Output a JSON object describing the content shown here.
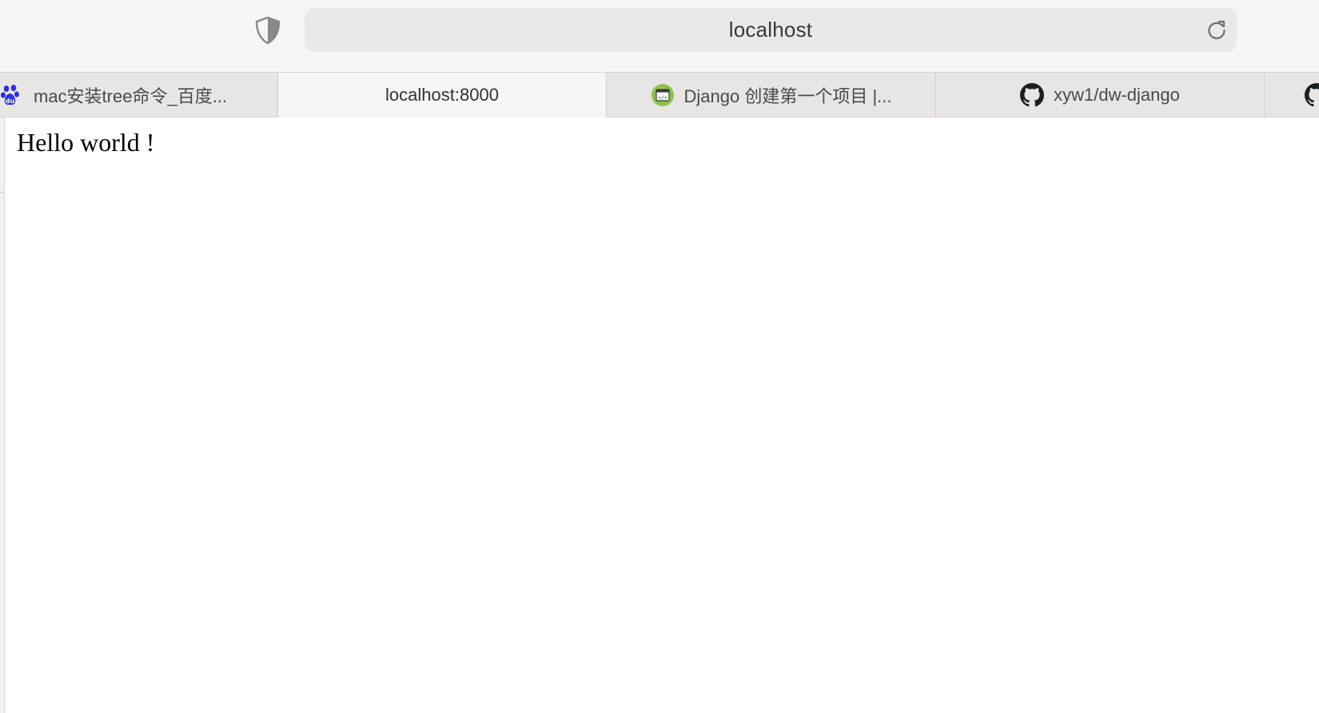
{
  "address_bar": {
    "url_display": "localhost"
  },
  "tabs": [
    {
      "title": "mac安装tree命令_百度...",
      "icon": "baidu-paw-icon",
      "active": false
    },
    {
      "title": "localhost:8000",
      "icon": "",
      "active": true
    },
    {
      "title": "Django 创建第一个项目 |...",
      "icon": "code-window-icon",
      "active": false
    },
    {
      "title": "xyw1/dw-django",
      "icon": "github-icon",
      "active": false
    },
    {
      "title": "",
      "icon": "github-icon",
      "active": false
    }
  ],
  "page": {
    "body_text": "Hello world !"
  },
  "icons": {
    "privacy": "shield-icon",
    "reload": "reload-icon"
  },
  "colors": {
    "toolbar_bg": "#f7f5f5",
    "address_bg": "#ebe8e8",
    "tabbar_bg": "#e8e5e5",
    "active_tab_bg": "#f7f5f5",
    "baidu_blue": "#2932e1",
    "code_icon_green": "#8bc34a"
  }
}
